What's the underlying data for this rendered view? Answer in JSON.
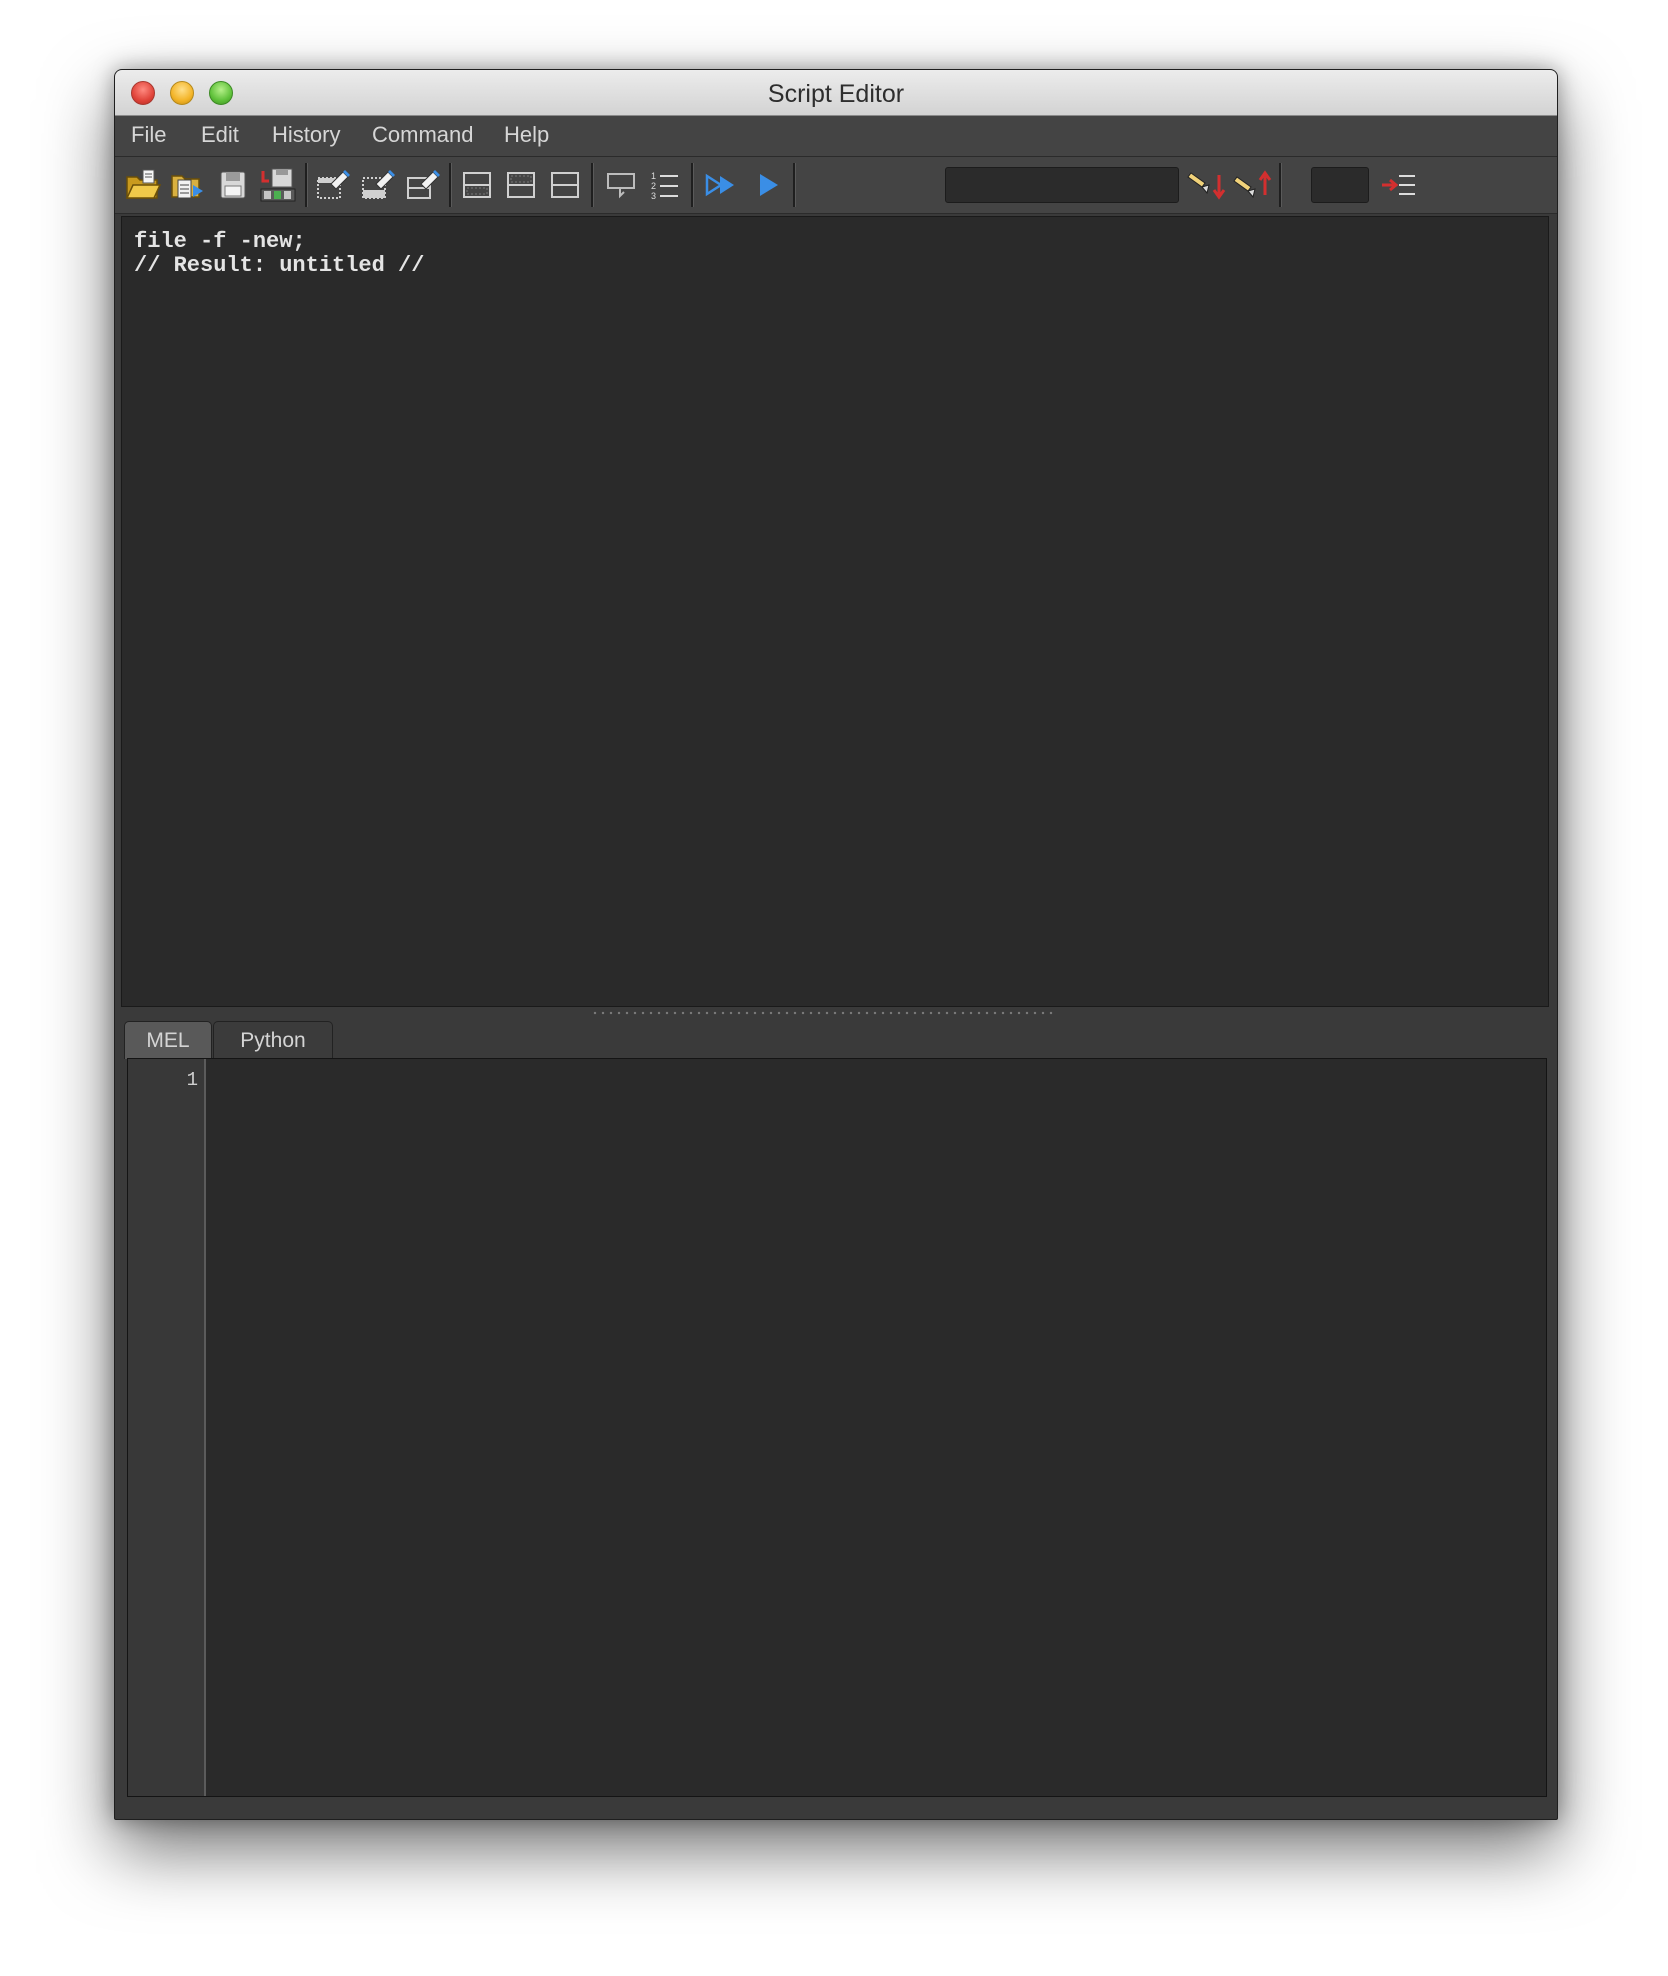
{
  "window": {
    "title": "Script Editor"
  },
  "menu": [
    "File",
    "Edit",
    "History",
    "Command",
    "Help"
  ],
  "toolbar": {
    "icons": [
      "open-script-icon",
      "source-script-icon",
      "save-script-icon",
      "save-to-shelf-icon",
      "clear-history-icon",
      "clear-input-icon",
      "clear-all-icon",
      "show-history-only-icon",
      "show-input-only-icon",
      "show-both-icon",
      "echo-all-commands-icon",
      "line-numbers-icon",
      "execute-all-icon",
      "execute-icon",
      "search-down-icon",
      "search-up-icon",
      "goto-line-icon"
    ],
    "search_value": "",
    "line_value": ""
  },
  "output": {
    "lines": [
      "file -f -new;",
      "// Result: untitled //"
    ]
  },
  "tabs": [
    "MEL",
    "Python"
  ],
  "input": {
    "line_numbers": [
      "1"
    ],
    "value": ""
  },
  "colors": {
    "background": "#2a2a2a",
    "panel": "#444444",
    "execute_blue": "#3a8ee6"
  }
}
